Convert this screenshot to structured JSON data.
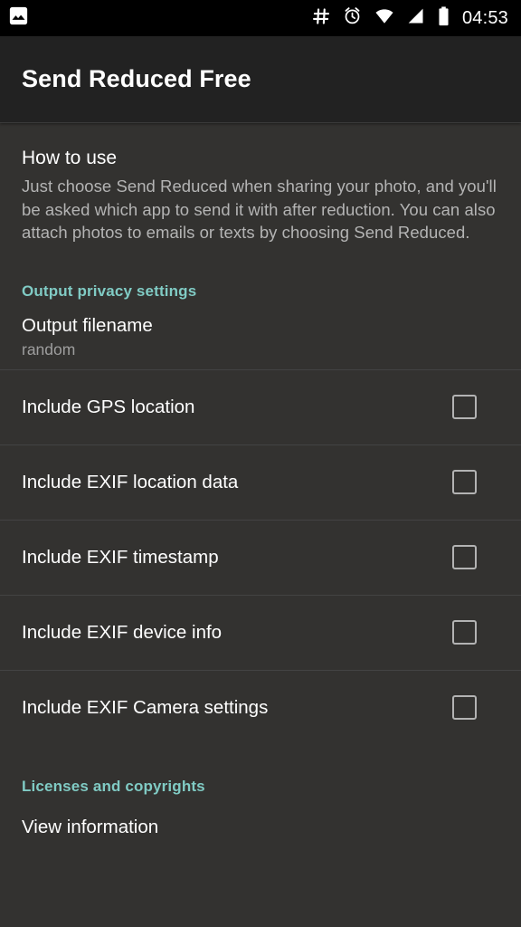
{
  "status_bar": {
    "left_icons": [
      {
        "name": "gallery-icon",
        "label": "photo"
      }
    ],
    "right_icons": [
      {
        "name": "hash-icon",
        "label": "#"
      },
      {
        "name": "alarm-clock-icon",
        "label": "alarm"
      },
      {
        "name": "wifi-icon",
        "label": "wifi"
      },
      {
        "name": "cellular-signal-icon",
        "label": "signal"
      },
      {
        "name": "battery-icon",
        "label": "battery"
      }
    ],
    "time": "04:53"
  },
  "app_bar": {
    "title": "Send Reduced Free"
  },
  "how_to_use": {
    "heading": "How to use",
    "body": "Just choose Send Reduced when sharing your photo, and you'll be asked which app to send it with after reduction. You can also attach photos to emails or texts by choosing Send Reduced."
  },
  "sections": {
    "privacy_header": "Output privacy settings",
    "licenses_header": "Licenses and copyrights"
  },
  "output_filename": {
    "title": "Output filename",
    "value": "random"
  },
  "checkbox_rows": [
    {
      "label": "Include GPS location",
      "checked": false
    },
    {
      "label": "Include EXIF location data",
      "checked": false
    },
    {
      "label": "Include EXIF timestamp",
      "checked": false
    },
    {
      "label": "Include EXIF device info",
      "checked": false
    },
    {
      "label": "Include EXIF Camera settings",
      "checked": false
    }
  ],
  "licenses": {
    "view_information": "View information"
  },
  "colors": {
    "accent": "#80cbc4",
    "background": "#333230",
    "app_bar": "#222222",
    "status_bar": "#000000",
    "primary_text": "#ffffff",
    "secondary_text": "#b4b4b4",
    "divider": "#434343"
  }
}
